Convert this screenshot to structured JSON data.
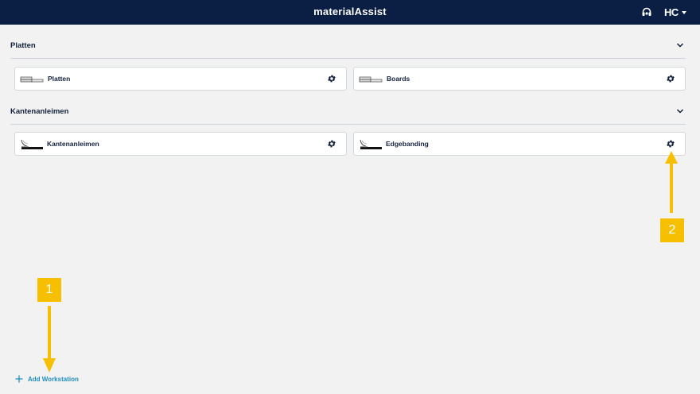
{
  "app": {
    "title": "materialAssist",
    "brand_logo": "HC"
  },
  "header": {
    "support_icon": "headset-icon",
    "menu_icon": "caret-down-icon"
  },
  "sections": [
    {
      "label": "Platten",
      "cards": [
        {
          "label": "Platten",
          "thumb": "boards-thumb",
          "action_icon": "gear-icon"
        },
        {
          "label": "Boards",
          "thumb": "boards-thumb",
          "action_icon": "gear-icon"
        }
      ]
    },
    {
      "label": "Kantenanleimen",
      "cards": [
        {
          "label": "Kantenanleimen",
          "thumb": "edgeband-thumb",
          "action_icon": "gear-icon"
        },
        {
          "label": "Edgebanding",
          "thumb": "edgeband-thumb",
          "action_icon": "gear-icon"
        }
      ]
    }
  ],
  "footer": {
    "add_label": "Add Workstation"
  },
  "callouts": [
    {
      "number": "1",
      "color": "#f6c000"
    },
    {
      "number": "2",
      "color": "#f6c000"
    }
  ],
  "colors": {
    "topbar": "#0b1f44",
    "accent": "#1f8fc0",
    "callout": "#f6c000"
  }
}
